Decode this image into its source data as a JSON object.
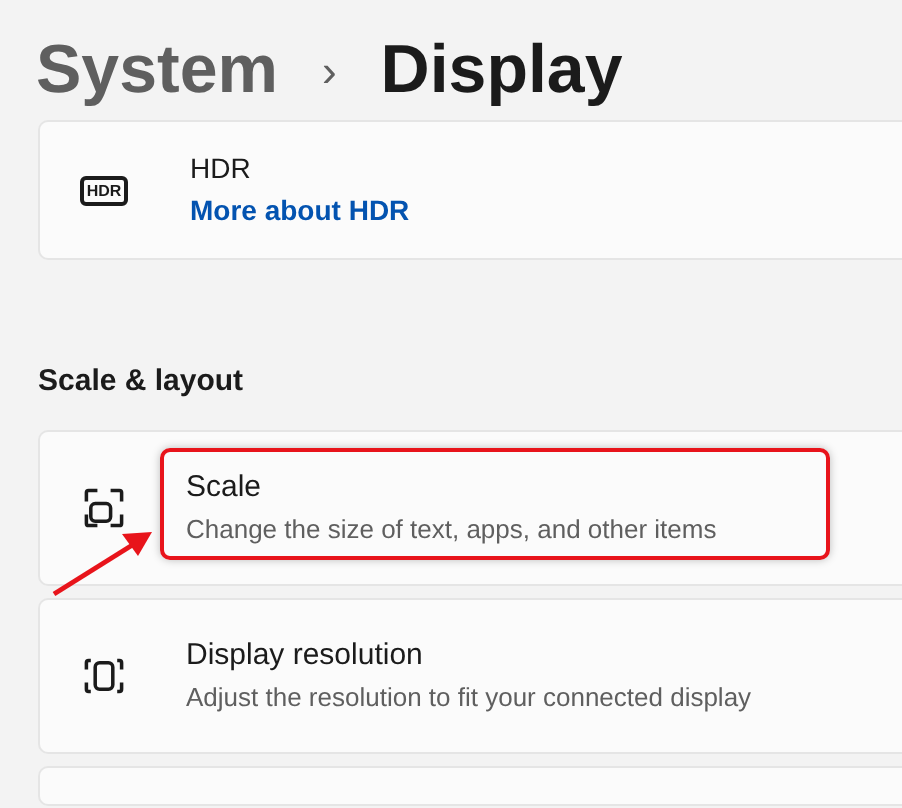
{
  "breadcrumb": {
    "parent": "System",
    "separator": "›",
    "current": "Display"
  },
  "hdr_card": {
    "icon_label": "HDR",
    "title": "HDR",
    "link": "More about HDR"
  },
  "section": {
    "title": "Scale & layout"
  },
  "settings": [
    {
      "kind": "scale",
      "title": "Scale",
      "subtitle": "Change the size of text, apps, and other items",
      "highlighted": true
    },
    {
      "kind": "resolution",
      "title": "Display resolution",
      "subtitle": "Adjust the resolution to fit your connected display",
      "highlighted": false
    }
  ]
}
